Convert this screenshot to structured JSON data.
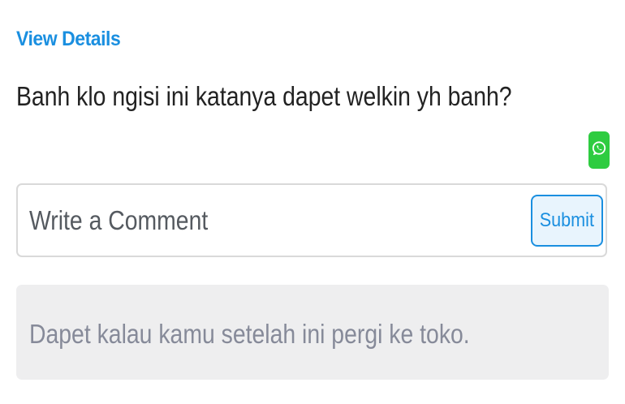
{
  "header": {
    "view_details_label": "View Details"
  },
  "post": {
    "question": "Banh klo ngisi ini katanya dapet welkin yh banh?"
  },
  "share": {
    "icon": "whatsapp-icon",
    "color": "#2ecc40"
  },
  "comment": {
    "placeholder": "Write a Comment",
    "value": "",
    "submit_label": "Submit"
  },
  "answer": {
    "text": "Dapet kalau kamu setelah ini pergi ke toko."
  },
  "colors": {
    "accent": "#1a8fe0",
    "text": "#222222",
    "answer_bg": "#eeeeef",
    "answer_text": "#868a99"
  }
}
